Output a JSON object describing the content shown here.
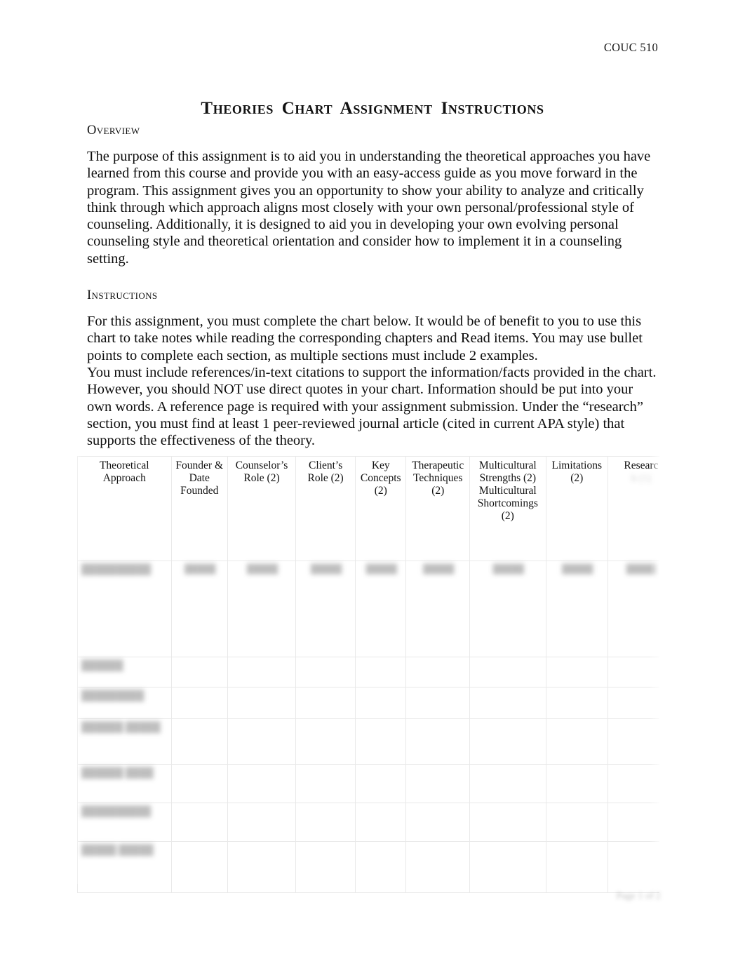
{
  "header": {
    "course_code": "COUC 510"
  },
  "title": "Theories  Chart Assignment  Instructions",
  "sections": {
    "overview": {
      "heading": "Overview",
      "paragraph": "The purpose of this assignment is to aid you in understanding the theoretical approaches you have learned from this course and provide you with an easy-access guide as you move forward in the program. This assignment gives you an opportunity to show your ability to analyze and critically think through which approach aligns most closely with your own personal/professional style of counseling. Additionally, it is designed to aid you in developing your own evolving personal counseling style and theoretical orientation and consider how to implement it in a counseling setting."
    },
    "instructions": {
      "heading": "Instructions",
      "paragraph_1": "For this assignment, you must complete the chart below. It would be of benefit to you to use this chart to take notes while reading the corresponding chapters and Read items. You may use bullet points to complete each section, as multiple sections must include 2 examples.",
      "paragraph_2": "You must include references/in-text citations to support the information/facts provided in the chart. However, you should NOT use direct quotes in your chart. Information should be put into your own words. A reference page is required with your assignment submission. Under the “research” section, you must find at least 1 peer-reviewed journal article (cited in current APA style) that supports the effectiveness of the theory."
    }
  },
  "chart": {
    "columns": [
      "Theoretical Approach",
      "Founder & Date Founded",
      "Counselor’s Role (2)",
      "Client’s Role (2)",
      "Key Concepts (2)",
      "Therapeutic Techniques (2)",
      "Multicultural Strengths (2) Multicultural Shortcomings (2)",
      "Limitations (2)",
      "Researc"
    ],
    "column_last_blurred_line": "h (1)",
    "rows": [
      {
        "cells": [
          "██████████",
          "█████",
          "█████",
          "█████",
          "█████",
          "█████",
          "█████",
          "█████",
          "█████"
        ]
      },
      {
        "cells": [
          "██████",
          "",
          "",
          "",
          "",
          "",
          "",
          "",
          ""
        ]
      },
      {
        "cells": [
          "█████████",
          "",
          "",
          "",
          "",
          "",
          "",
          "",
          ""
        ]
      },
      {
        "cells": [
          "██████ █████",
          "",
          "",
          "",
          "",
          "",
          "",
          "",
          ""
        ]
      },
      {
        "cells": [
          "██████ ████",
          "",
          "",
          "",
          "",
          "",
          "",
          "",
          ""
        ]
      },
      {
        "cells": [
          "██████████",
          "",
          "",
          "",
          "",
          "",
          "",
          "",
          ""
        ]
      },
      {
        "cells": [
          "█████ █████",
          "",
          "",
          "",
          "",
          "",
          "",
          "",
          ""
        ]
      }
    ]
  },
  "footer": {
    "page_label": "Page 1 of 2"
  }
}
